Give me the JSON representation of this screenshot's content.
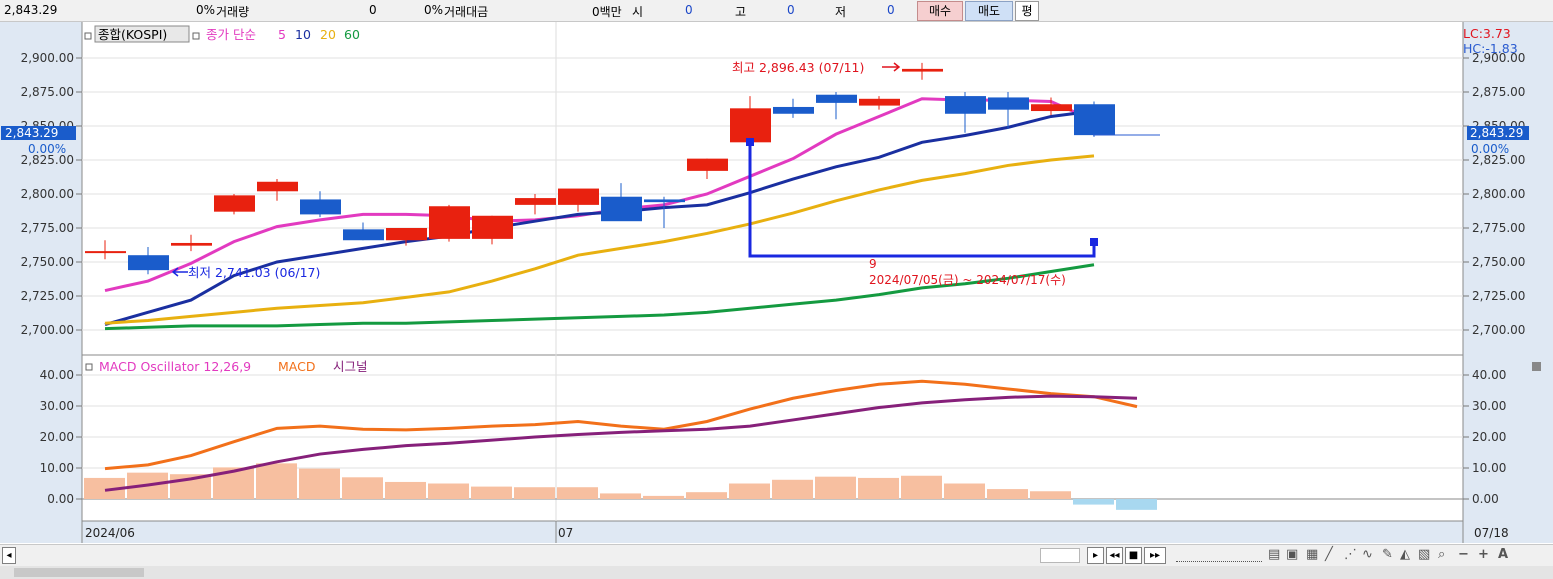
{
  "toolbar": {
    "price": "2,843.29",
    "vol_pct": "0%",
    "vol_label": "거래량",
    "vol_value": "0",
    "amt_pct": "0%",
    "amt_label": "거래대금",
    "amt_value": "0백만",
    "open_label": "시",
    "open_value": "0",
    "high_label": "고",
    "high_value": "0",
    "low_label": "저",
    "low_value": "0",
    "buy_label": "매수",
    "sell_label": "매도",
    "avg_label": "평"
  },
  "colors": {
    "up": "#e8210f",
    "down": "#1a5ccb",
    "ma5": "#e23ac0",
    "ma10": "#1a2fa0",
    "ma20": "#e8b010",
    "ma60": "#149a40",
    "macd": "#f2701a",
    "signal": "#86207a",
    "osc_pos": "#f7bfa0",
    "osc_neg": "#a8d8f0",
    "axis_bg": "#dfe8f3"
  },
  "legend": {
    "main_icon": "□",
    "main_name": "종합(KOSPI)",
    "ma_label": "종가 단순",
    "ma5": "5",
    "ma10": "10",
    "ma20": "20",
    "ma60": "60",
    "macd_label": "MACD Oscillator 12,26,9",
    "macd_name": "MACD",
    "signal_name": "시그널"
  },
  "labels": {
    "current_price": "2,843.29",
    "current_pct": "0.00%",
    "lc": "LC:3.73",
    "hc": "HC:-1.83",
    "high_note": "최고 2,896.43 (07/11)",
    "low_note": "최저 2,741.03 (06/17)",
    "count": "9",
    "range": "2024/07/05(금) ~ 2024/07/17(수)",
    "x_start": "2024/06",
    "x_mid": "07",
    "x_end": "07/18"
  },
  "chart_data": [
    {
      "type": "candlestick",
      "title": "종합(KOSPI)",
      "ylim": [
        2690,
        2915
      ],
      "y_ticks": [
        "2,700.00",
        "2,725.00",
        "2,750.00",
        "2,775.00",
        "2,800.00",
        "2,825.00",
        "2,850.00",
        "2,875.00",
        "2,900.00"
      ],
      "candles": [
        {
          "o": 2758,
          "h": 2766,
          "l": 2752,
          "c": 2758
        },
        {
          "o": 2755,
          "h": 2761,
          "l": 2741.03,
          "c": 2744
        },
        {
          "o": 2762,
          "h": 2770,
          "l": 2758,
          "c": 2764
        },
        {
          "o": 2787,
          "h": 2800,
          "l": 2785,
          "c": 2799
        },
        {
          "o": 2802,
          "h": 2811,
          "l": 2795,
          "c": 2809
        },
        {
          "o": 2796,
          "h": 2802,
          "l": 2783,
          "c": 2785
        },
        {
          "o": 2774,
          "h": 2779,
          "l": 2766,
          "c": 2766
        },
        {
          "o": 2766,
          "h": 2775,
          "l": 2762,
          "c": 2775
        },
        {
          "o": 2767,
          "h": 2792,
          "l": 2765,
          "c": 2791
        },
        {
          "o": 2767,
          "h": 2784,
          "l": 2763,
          "c": 2784
        },
        {
          "o": 2792,
          "h": 2800,
          "l": 2785,
          "c": 2797
        },
        {
          "o": 2792,
          "h": 2803,
          "l": 2787,
          "c": 2804
        },
        {
          "o": 2798,
          "h": 2808,
          "l": 2781,
          "c": 2780
        },
        {
          "o": 2796,
          "h": 2798,
          "l": 2775,
          "c": 2794
        },
        {
          "o": 2817,
          "h": 2826,
          "l": 2811,
          "c": 2826
        },
        {
          "o": 2838,
          "h": 2872,
          "l": 2835,
          "c": 2863
        },
        {
          "o": 2864,
          "h": 2870,
          "l": 2856,
          "c": 2859
        },
        {
          "o": 2873,
          "h": 2875,
          "l": 2855,
          "c": 2867
        },
        {
          "o": 2865,
          "h": 2872,
          "l": 2862,
          "c": 2870
        },
        {
          "o": 2890,
          "h": 2896.43,
          "l": 2884,
          "c": 2892
        },
        {
          "o": 2872,
          "h": 2875,
          "l": 2845,
          "c": 2859
        },
        {
          "o": 2871,
          "h": 2875,
          "l": 2848,
          "c": 2862
        },
        {
          "o": 2861,
          "h": 2871,
          "l": 2858,
          "c": 2866
        },
        {
          "o": 2866,
          "h": 2868,
          "l": 2842,
          "c": 2843.29
        }
      ],
      "series": [
        {
          "name": "5",
          "values": [
            2729,
            2736,
            2749,
            2765,
            2776,
            2781,
            2785,
            2785,
            2784,
            2780,
            2781,
            2784,
            2789,
            2792,
            2800,
            2813,
            2826,
            2844,
            2857,
            2870,
            2869,
            2869,
            2868,
            2854
          ]
        },
        {
          "name": "10",
          "values": [
            2704,
            2713,
            2722,
            2740,
            2750,
            2755,
            2760,
            2765,
            2769,
            2775,
            2780,
            2785,
            2787,
            2790,
            2792,
            2801,
            2811,
            2820,
            2827,
            2838,
            2843,
            2849,
            2857,
            2861
          ]
        },
        {
          "name": "20",
          "values": [
            2705,
            2707,
            2710,
            2713,
            2716,
            2718,
            2720,
            2724,
            2728,
            2736,
            2745,
            2755,
            2760,
            2765,
            2771,
            2778,
            2786,
            2795,
            2803,
            2810,
            2815,
            2821,
            2825,
            2828
          ]
        },
        {
          "name": "60",
          "values": [
            2701,
            2702,
            2703,
            2703,
            2703,
            2704,
            2705,
            2705,
            2706,
            2707,
            2708,
            2709,
            2710,
            2711,
            2713,
            2716,
            2719,
            2722,
            2726,
            2731,
            2734,
            2738,
            2743,
            2748
          ]
        }
      ]
    },
    {
      "type": "bar-line",
      "title": "MACD Oscillator 12,26,9",
      "ylim": [
        -3,
        45
      ],
      "y_ticks": [
        "0.00",
        "10.00",
        "20.00",
        "30.00",
        "40.00"
      ],
      "oscillator": [
        6.8,
        8.5,
        8.0,
        10.2,
        11.5,
        9.8,
        7.0,
        5.5,
        5.0,
        4.0,
        3.8,
        3.8,
        1.8,
        1.0,
        2.2,
        5.0,
        6.2,
        7.2,
        6.8,
        7.5,
        5.0,
        3.2,
        2.5,
        -1.8,
        -3.5
      ],
      "series": [
        {
          "name": "MACD",
          "values": [
            9.8,
            11.0,
            14.0,
            18.5,
            22.8,
            23.5,
            22.5,
            22.3,
            22.8,
            23.5,
            24.0,
            25.0,
            23.5,
            22.5,
            25.0,
            29.0,
            32.5,
            35.0,
            37.0,
            38.0,
            37.0,
            35.5,
            34.0,
            33.0,
            29.8
          ]
        },
        {
          "name": "시그널",
          "values": [
            2.8,
            4.5,
            6.5,
            9.0,
            12.0,
            14.5,
            16.0,
            17.2,
            18.0,
            19.0,
            20.0,
            20.8,
            21.5,
            22.0,
            22.5,
            23.5,
            25.5,
            27.5,
            29.5,
            31.0,
            32.0,
            32.8,
            33.2,
            33.0,
            32.5
          ]
        }
      ]
    }
  ]
}
